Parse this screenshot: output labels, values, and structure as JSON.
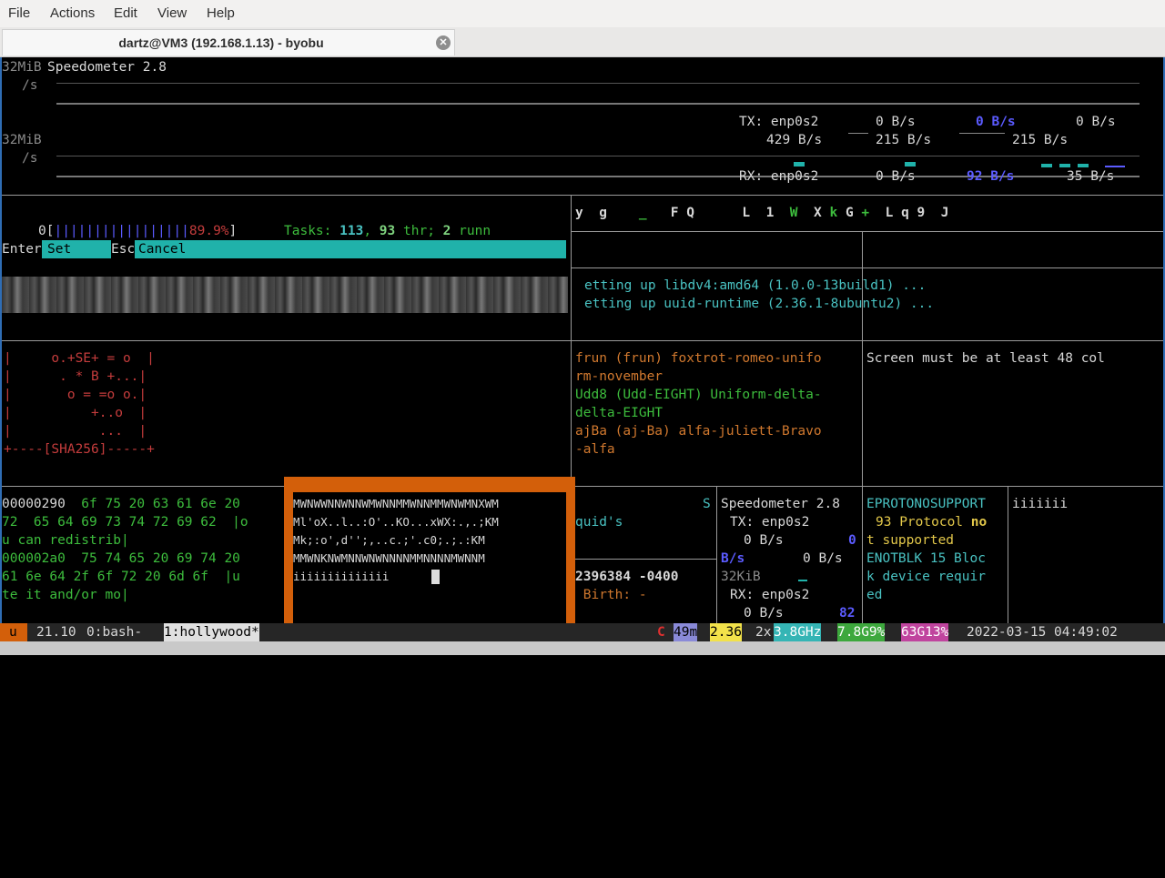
{
  "menu": {
    "file": "File",
    "actions": "Actions",
    "edit": "Edit",
    "view": "View",
    "help": "Help"
  },
  "tab": {
    "title": "dartz@VM3 (192.168.1.13) - byobu"
  },
  "speedometer_top": {
    "unit1": "32MiB",
    "unit1b": "/s",
    "title": "Speedometer 2.8",
    "unit2": "32MiB",
    "unit2b": "/s",
    "tx_label": "TX: enp0s2",
    "tx_v1": "0 B/s",
    "tx_v2": "0 B/s",
    "tx_v3": "0 B/s",
    "tx_r1": "429 B/s",
    "tx_r2": "215 B/s",
    "tx_r3": "215 B/s",
    "rx_label": "RX: enp0s2",
    "rx_v1": "0 B/s",
    "rx_v2": "92 B/s",
    "rx_v3": "35 B/s"
  },
  "htop": {
    "cpu_num": "0",
    "cpu_open": "[",
    "cpu_bars": "|||||||||||||||||",
    "cpu_pct": "89.9%",
    "cpu_close": "]",
    "tasks_label": "Tasks:",
    "tasks": "113",
    "comma": ",",
    "thr": "93",
    "thr_label": "thr;",
    "running": "2",
    "running_label": "runn",
    "fn_enter": "Enter",
    "fn_set": "Set",
    "fn_esc": "Esc",
    "fn_cancel": "Cancel"
  },
  "glyph_row": {
    "chars": [
      "y",
      "g",
      "_",
      "F",
      "Q",
      "L",
      "1",
      "W",
      "X",
      "k",
      "G",
      "+",
      "L",
      "q",
      "9",
      "J"
    ]
  },
  "apt": {
    "line1": "etting up libdv4:amd64 (1.0.0-13build1) ...",
    "line2": "etting up uuid-runtime (2.36.1-8ubuntu2) ..."
  },
  "randomart": {
    "lines": [
      "|     o.+SE+ = o  |",
      "|      . * B +...|",
      "|       o = =o o.|",
      "|          +..o  |",
      "|           ...  |",
      "+----[SHA256]-----+"
    ]
  },
  "users": {
    "lines": [
      "frun (frun) foxtrot-romeo-unifo",
      "rm-november",
      "Udd8 (Udd-EIGHT) Uniform-delta-",
      "delta-EIGHT",
      "ajBa (aj-Ba) alfa-juliett-Bravo",
      "-alfa"
    ]
  },
  "screen_msg": "Screen must be at least 48 col",
  "hexdump": {
    "lines": [
      {
        "addr": "00000290",
        "hex": "  6f 75 20 63 61 6e 20"
      },
      {
        "addr": "72",
        "hex": "  65 64 69 73 74 72 69 62  |o"
      },
      {
        "addr": "u can redistrib|",
        "hex": ""
      },
      {
        "addr": "000002a0",
        "hex": "  75 74 65 20 69 74 20"
      },
      {
        "addr": "61",
        "hex": " 6e 64 2f 6f 72 20 6d 6f  |u"
      },
      {
        "addr": "te it and/or mo|",
        "hex": ""
      }
    ]
  },
  "ascii_art": {
    "lines": [
      "MWNWWNNWNNWMWNNMMWNNMMWNWMNXWM",
      "Ml'oX..l..:O'..KO...xWX:.,.;KM",
      "Mk;:o',d'';,..c.;'.c0;.;.:KM",
      "MMWNKNWMNNWNWNNNNMMNNNNMWNNM",
      "iiiiiiiiiiiiii"
    ]
  },
  "stat_pane": {
    "s": "S",
    "quid": "quid's",
    "date": "2396384 -0400",
    "birth": " Birth: -"
  },
  "speedometer_small": {
    "title": "Speedometer 2.8",
    "tx_label": "TX: enp0s2",
    "tx_v1": "0 B/s",
    "tx_v2": "0",
    "tx_u": "B/s",
    "tx_v3": "0 B/s",
    "unit": "32KiB",
    "rx_label": "RX: enp0s2",
    "rx_v1": "0 B/s",
    "rx_v2": "82"
  },
  "errno": {
    "lines": [
      "EPROTONOSUPPORT",
      "93 Protocol ",
      "t supported",
      "ENOTBLK 15 Bloc",
      "k device requir",
      "ed"
    ],
    "no": "no"
  },
  "iii": "iiiiiii",
  "status": {
    "u": "u",
    "version": "21.10",
    "win0": "0:bash-",
    "win1": "1:hollywood*",
    "c": "C",
    "mem": "49m",
    "load": "2.36",
    "cpu_count": "2x",
    "freq": "3.8GHz",
    "mem_total": "7.8G",
    "mem_pct": "9%",
    "disk": "63G",
    "disk_pct": "13%",
    "datetime": "2022-03-15 04:49:02"
  },
  "colors": {
    "accent": "#d35f0a",
    "teal": "#20b2aa",
    "border": "#2f6db5"
  }
}
